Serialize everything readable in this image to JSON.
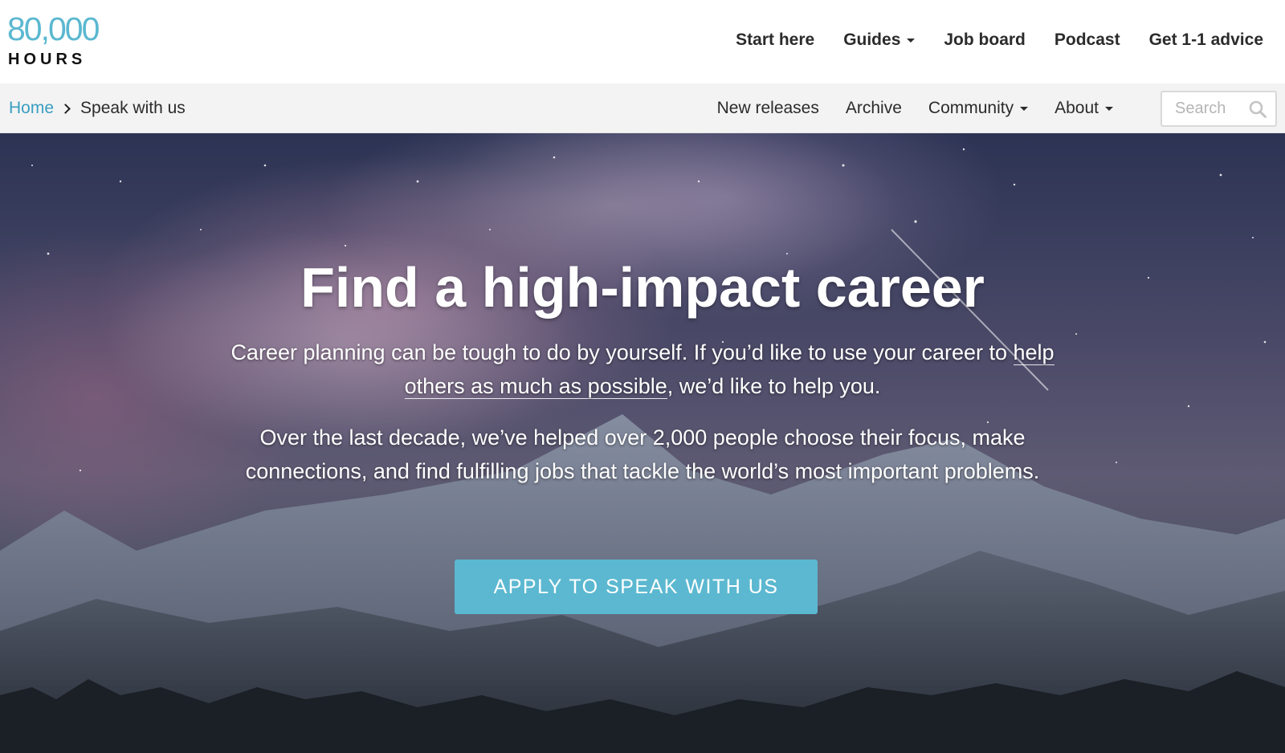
{
  "logo": {
    "number": "80,000",
    "word": "HOURS"
  },
  "main_nav": {
    "items": [
      {
        "label": "Start here",
        "dropdown": false
      },
      {
        "label": "Guides",
        "dropdown": true
      },
      {
        "label": "Job board",
        "dropdown": false
      },
      {
        "label": "Podcast",
        "dropdown": false
      },
      {
        "label": "Get 1-1 advice",
        "dropdown": false
      }
    ]
  },
  "breadcrumb": {
    "home": "Home",
    "current": "Speak with us"
  },
  "sub_nav": {
    "items": [
      {
        "label": "New releases",
        "dropdown": false
      },
      {
        "label": "Archive",
        "dropdown": false
      },
      {
        "label": "Community",
        "dropdown": true
      },
      {
        "label": "About",
        "dropdown": true
      }
    ]
  },
  "search": {
    "placeholder": "Search",
    "icon": "search-icon"
  },
  "hero": {
    "title": "Find a high-impact career",
    "p1_before": "Career planning can be tough to do by yourself. If you’d like to use your career to ",
    "p1_link": "help others as much as possible",
    "p1_after": ", we’d like to help you.",
    "p2": "Over the last decade, we’ve helped over 2,000 people choose their focus, make connections, and find fulfilling jobs that tackle the world’s most important problems.",
    "cta": "APPLY TO SPEAK WITH US"
  },
  "colors": {
    "accent": "#5bb8d0",
    "link": "#3a9ec0",
    "subbar_bg": "#f3f3f3",
    "text": "#2b2b2b"
  }
}
